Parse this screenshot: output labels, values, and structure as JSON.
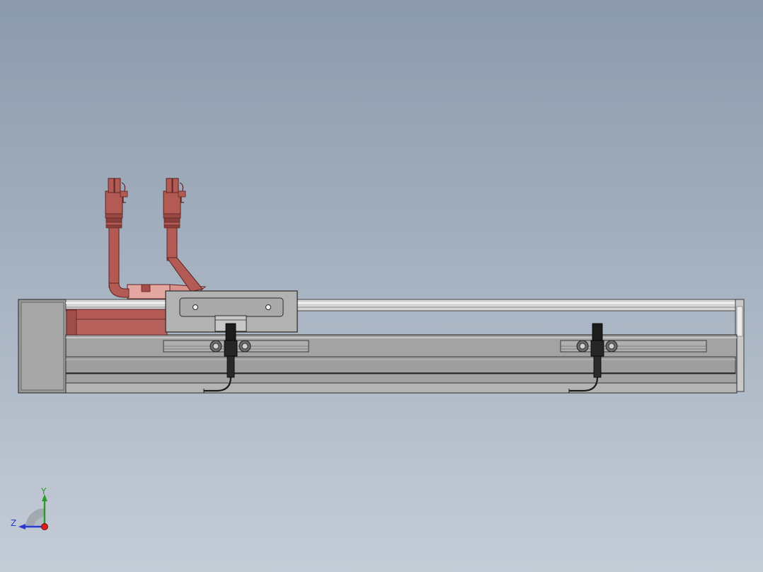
{
  "colors": {
    "background_top": "#8b9aac",
    "background_bottom": "#c4ccd7",
    "aluminum": "#a8a8a8",
    "aluminum_dark": "#7c7c7c",
    "aluminum_light": "#cfcfcf",
    "rail": "#e6e6e6",
    "carriage": "#b2b2b2",
    "fitting": "#b35a55",
    "fitting_dark": "#7a3532",
    "fitting_light": "#e3a6a0",
    "sensor": "#202020",
    "axis_x": "#d42020",
    "axis_y": "#2a9a2a",
    "axis_z": "#2a3ad4"
  },
  "triad": {
    "y_label": "Y",
    "z_label": "Z"
  }
}
